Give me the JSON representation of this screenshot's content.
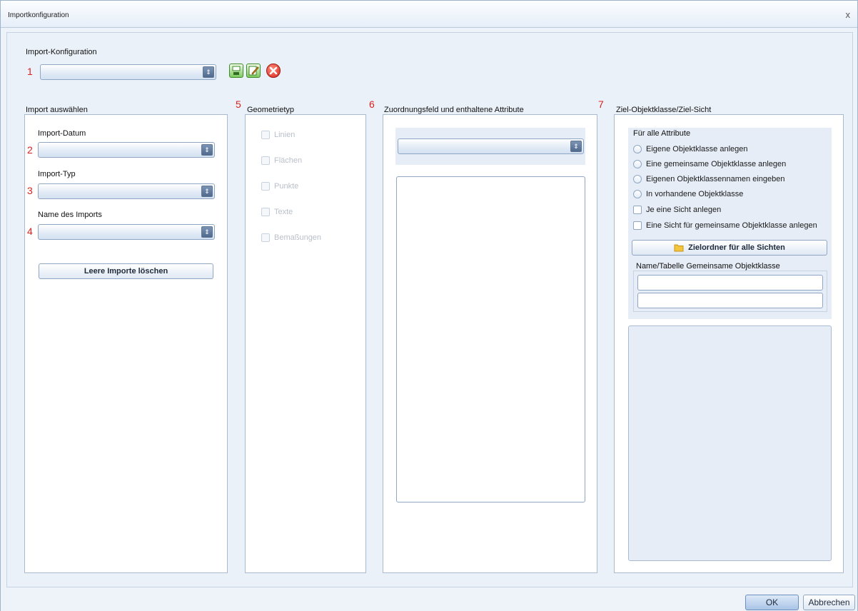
{
  "window": {
    "title": "Importkonfiguration",
    "close_label": "x"
  },
  "config": {
    "label": "Import-Konfiguration",
    "marker": "1",
    "icons": [
      "save-icon",
      "edit-icon",
      "delete-icon"
    ]
  },
  "import_panel": {
    "title": "Import auswählen",
    "date_label": "Import-Datum",
    "date_marker": "2",
    "type_label": "Import-Typ",
    "type_marker": "3",
    "name_label": "Name des Imports",
    "name_marker": "4",
    "clear_button": "Leere Importe löschen"
  },
  "geometry_panel": {
    "marker": "5",
    "title": "Geometrietyp",
    "options": [
      "Linien",
      "Flächen",
      "Punkte",
      "Texte",
      "Bemaßungen"
    ]
  },
  "mapping_panel": {
    "marker": "6",
    "title": "Zuordnungsfeld und enthaltene Attribute"
  },
  "target_panel": {
    "marker": "7",
    "title": "Ziel-Objektklasse/Ziel-Sicht",
    "group_title": "Für alle Attribute",
    "radios": [
      "Eigene Objektklasse anlegen",
      "Eine gemeinsame Objektklasse anlegen",
      "Eigenen Objektklassennamen eingeben",
      "In vorhandene Objektklasse"
    ],
    "checks": [
      "Je eine Sicht anlegen",
      "Eine Sicht für gemeinsame Objektklasse anlegen"
    ],
    "folder_button": "Zielordner für alle Sichten",
    "shared_label": "Name/Tabelle Gemeinsame Objektklasse"
  },
  "footer": {
    "ok": "OK",
    "cancel": "Abbrechen"
  },
  "colors": {
    "marker": "#d9231f",
    "accent": "#4f6b91"
  }
}
